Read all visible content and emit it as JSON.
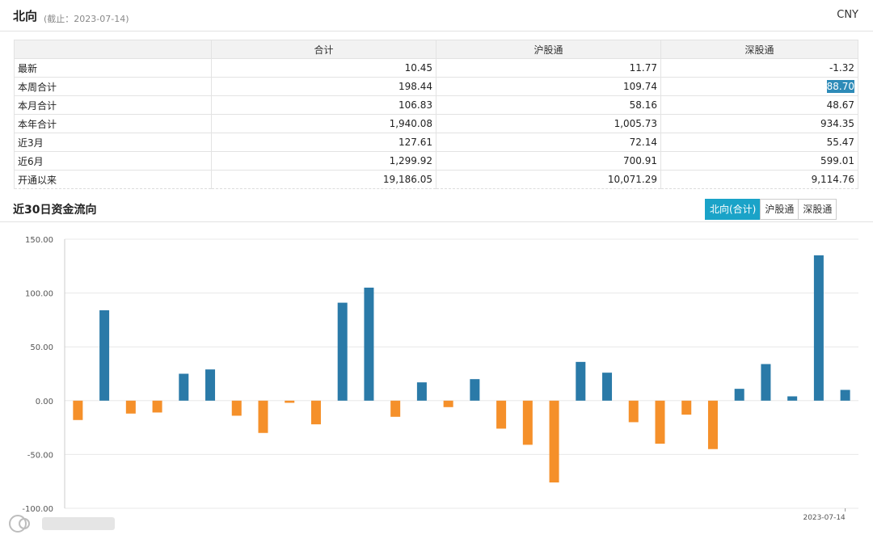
{
  "header": {
    "title": "北向",
    "as_of": "(截止：2023-07-14)",
    "currency": "CNY"
  },
  "summary": {
    "columns": [
      "",
      "合计",
      "沪股通",
      "深股通"
    ],
    "rows": [
      {
        "label": "最新",
        "values": [
          "10.45",
          "11.77",
          "-1.32"
        ]
      },
      {
        "label": "本周合计",
        "values": [
          "198.44",
          "109.74",
          "88.70"
        ]
      },
      {
        "label": "本月合计",
        "values": [
          "106.83",
          "58.16",
          "48.67"
        ]
      },
      {
        "label": "本年合计",
        "values": [
          "1,940.08",
          "1,005.73",
          "934.35"
        ]
      },
      {
        "label": "近3月",
        "values": [
          "127.61",
          "72.14",
          "55.47"
        ]
      },
      {
        "label": "近6月",
        "values": [
          "1,299.92",
          "700.91",
          "599.01"
        ]
      },
      {
        "label": "开通以来",
        "values": [
          "19,186.05",
          "10,071.29",
          "9,114.76"
        ]
      }
    ]
  },
  "section": {
    "title": "近30日资金流向",
    "tabs": [
      {
        "label": "北向(合计)",
        "active": true
      },
      {
        "label": "沪股通",
        "active": false
      },
      {
        "label": "深股通",
        "active": false
      }
    ]
  },
  "colors": {
    "positive": "#2a7aa8",
    "negative": "#f5902a",
    "tab_active": "#1aa3c8",
    "highlight": "#2e8bb8"
  },
  "watermark": {
    "icon": "app-logo-icon"
  },
  "chart_data": {
    "type": "bar",
    "title": "",
    "xlabel": "",
    "ylabel": "",
    "ylim": [
      -100,
      150
    ],
    "yticks": [
      "150.00",
      "100.00",
      "50.00",
      "0.00",
      "-50.00",
      "-100.00"
    ],
    "x_last_label": "2023-07-14",
    "grid": true,
    "values": [
      -18,
      84,
      -12,
      -11,
      25,
      29,
      -14,
      -30,
      -2,
      -22,
      91,
      105,
      -15,
      17,
      -6,
      20,
      -26,
      -41,
      -76,
      36,
      26,
      -20,
      -40,
      -13,
      -45,
      11,
      34,
      4,
      135,
      10
    ]
  }
}
